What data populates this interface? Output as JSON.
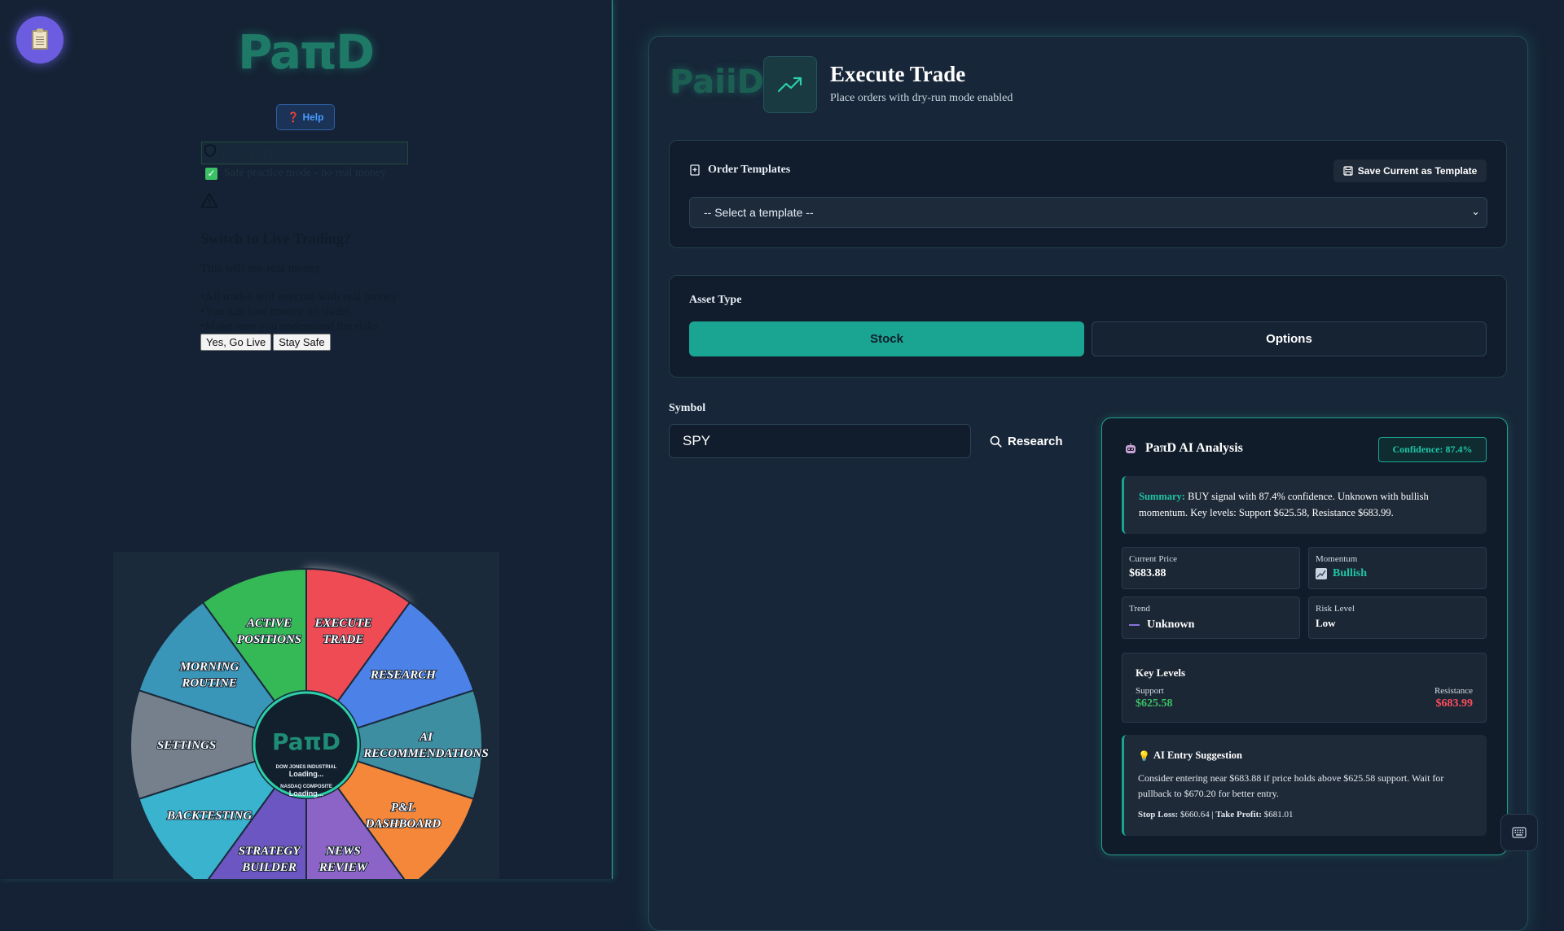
{
  "sidebar": {
    "logo_text": "PaπD",
    "help_label": "Help",
    "paper_label": "PAPER TRADING",
    "safe_text": "Safe practice mode - no real money",
    "live_title": "Switch to Live Trading?",
    "live_sub": "This will use real money",
    "live_bullets": [
      "•All trades will execute with real money",
      "•You can lose money on trades",
      "•Make sure you understand the risks"
    ],
    "btn_go_live": "Yes, Go Live",
    "btn_stay_safe": "Stay Safe"
  },
  "wheel": {
    "segments": [
      {
        "label": "EXECUTE TRADE",
        "color": "#ef4b55"
      },
      {
        "label": "RESEARCH",
        "color": "#4c82e8"
      },
      {
        "label": "AI RECOMMENDATIONS",
        "color": "#3e8ea1"
      },
      {
        "label": "P&L DASHBOARD",
        "color": "#f5873a"
      },
      {
        "label": "NEWS REVIEW",
        "color": "#8c64c8"
      },
      {
        "label": "STRATEGY BUILDER",
        "color": "#6c56c2"
      },
      {
        "label": "BACKTESTING",
        "color": "#3ab3cf"
      },
      {
        "label": "SETTINGS",
        "color": "#76808c"
      },
      {
        "label": "MORNING ROUTINE",
        "color": "#3a96b8"
      },
      {
        "label": "ACTIVE POSITIONS",
        "color": "#35b856"
      }
    ],
    "center_logo": "PaπD",
    "center_lines": [
      "DOW JONES INDUSTRIAL",
      "Loading...",
      "NASDAQ COMPOSITE",
      "Loading..."
    ]
  },
  "header": {
    "logo_text": "PaiiD",
    "title": "Execute Trade",
    "subtitle": "Place orders with dry-run mode enabled"
  },
  "templates": {
    "title": "Order Templates",
    "save_label": "Save Current as Template",
    "select_value": "-- Select a template --"
  },
  "asset": {
    "title": "Asset Type",
    "options": [
      "Stock",
      "Options"
    ],
    "selected": "Stock"
  },
  "symbol": {
    "label": "Symbol",
    "value": "SPY",
    "research_label": "Research"
  },
  "ai": {
    "title": "PaπD AI Analysis",
    "confidence": "Confidence: 87.4%",
    "summary_label": "Summary:",
    "summary_text": "BUY signal with 87.4% confidence. Unknown with bullish momentum. Key levels: Support $625.58, Resistance $683.99.",
    "current_price_label": "Current Price",
    "current_price": "$683.88",
    "momentum_label": "Momentum",
    "momentum": "Bullish",
    "trend_label": "Trend",
    "trend": "Unknown",
    "risk_label": "Risk Level",
    "risk": "Low",
    "key_levels_title": "Key Levels",
    "support_label": "Support",
    "support": "$625.58",
    "resistance_label": "Resistance",
    "resistance": "$683.99",
    "entry_title": "AI Entry Suggestion",
    "entry_text": "Consider entering near $683.88 if price holds above $625.58 support. Wait for pullback to $670.20 for better entry.",
    "stop_loss_label": "Stop Loss:",
    "stop_loss": "$660.64",
    "take_profit_label": "Take Profit:",
    "take_profit": "$681.01"
  },
  "colors": {
    "accent": "#1aa593",
    "support": "#3cc066",
    "resistance": "#ff4d5e",
    "bg": "#152235"
  }
}
